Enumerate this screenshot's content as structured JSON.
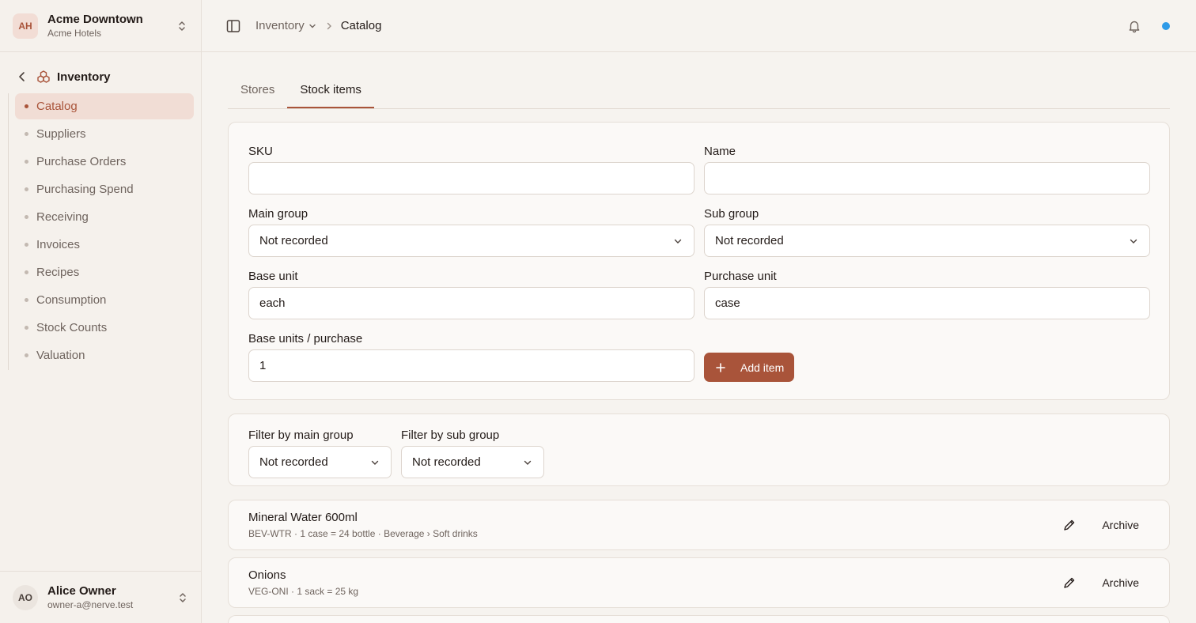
{
  "org": {
    "initials": "AH",
    "name": "Acme Downtown",
    "subtitle": "Acme Hotels"
  },
  "section": {
    "title": "Inventory"
  },
  "nav": [
    {
      "label": "Catalog",
      "active": true
    },
    {
      "label": "Suppliers"
    },
    {
      "label": "Purchase Orders"
    },
    {
      "label": "Purchasing Spend"
    },
    {
      "label": "Receiving"
    },
    {
      "label": "Invoices"
    },
    {
      "label": "Recipes"
    },
    {
      "label": "Consumption"
    },
    {
      "label": "Stock Counts"
    },
    {
      "label": "Valuation"
    }
  ],
  "user": {
    "initials": "AO",
    "name": "Alice Owner",
    "email": "owner-a@nerve.test"
  },
  "breadcrumb": {
    "parent": "Inventory",
    "current": "Catalog"
  },
  "tabs": [
    {
      "label": "Stores"
    },
    {
      "label": "Stock items",
      "active": true
    }
  ],
  "form": {
    "sku": {
      "label": "SKU",
      "value": ""
    },
    "name": {
      "label": "Name",
      "value": ""
    },
    "main_group": {
      "label": "Main group",
      "value": "Not recorded"
    },
    "sub_group": {
      "label": "Sub group",
      "value": "Not recorded"
    },
    "base_unit": {
      "label": "Base unit",
      "value": "each"
    },
    "purchase_unit": {
      "label": "Purchase unit",
      "value": "case"
    },
    "base_per_purchase": {
      "label": "Base units / purchase",
      "value": "1"
    },
    "add_label": "Add item"
  },
  "filters": {
    "main": {
      "label": "Filter by main group",
      "value": "Not recorded"
    },
    "sub": {
      "label": "Filter by sub group",
      "value": "Not recorded"
    }
  },
  "items": [
    {
      "title": "Mineral Water 600ml",
      "details": "BEV-WTR · 1 case = 24 bottle · Beverage › Soft drinks",
      "archive": "Archive"
    },
    {
      "title": "Onions",
      "details": "VEG-ONI · 1 sack = 25 kg",
      "archive": "Archive"
    }
  ],
  "colors": {
    "accent": "#a9543a",
    "status": "#2f9be8"
  }
}
